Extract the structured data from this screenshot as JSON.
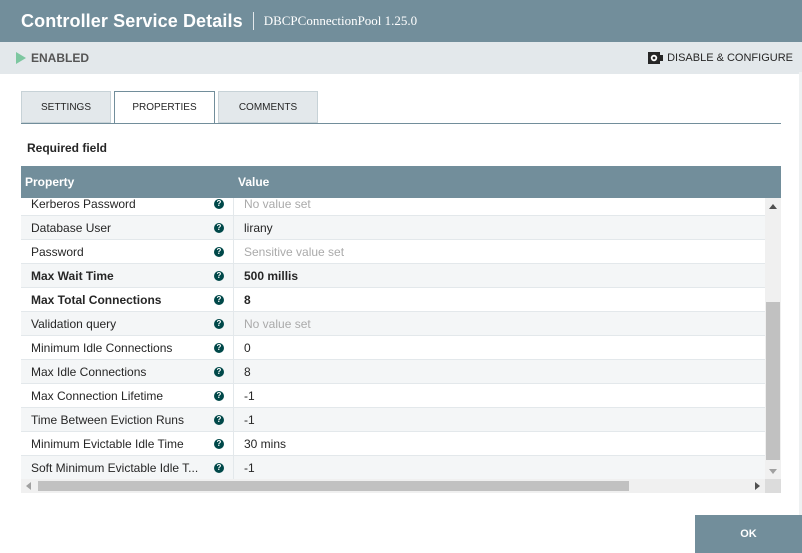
{
  "header": {
    "title": "Controller Service Details",
    "subtitle": "DBCPConnectionPool 1.25.0"
  },
  "status": {
    "state": "ENABLED",
    "state_color": "#7dc7a0",
    "action_label": "DISABLE & CONFIGURE",
    "action_icon": "gear-config-icon"
  },
  "tabs": [
    {
      "label": "SETTINGS",
      "active": false
    },
    {
      "label": "PROPERTIES",
      "active": true
    },
    {
      "label": "COMMENTS",
      "active": false
    }
  ],
  "required_label": "Required field",
  "grid": {
    "columns": [
      "Property",
      "Value"
    ],
    "rows": [
      {
        "property": "Kerberos Password",
        "value": "No value set",
        "required": false,
        "is_set": false
      },
      {
        "property": "Database User",
        "value": "lirany",
        "required": false,
        "is_set": true
      },
      {
        "property": "Password",
        "value": "Sensitive value set",
        "required": false,
        "is_set": false
      },
      {
        "property": "Max Wait Time",
        "value": "500 millis",
        "required": true,
        "is_set": true
      },
      {
        "property": "Max Total Connections",
        "value": "8",
        "required": true,
        "is_set": true
      },
      {
        "property": "Validation query",
        "value": "No value set",
        "required": false,
        "is_set": false
      },
      {
        "property": "Minimum Idle Connections",
        "value": "0",
        "required": false,
        "is_set": true
      },
      {
        "property": "Max Idle Connections",
        "value": "8",
        "required": false,
        "is_set": true
      },
      {
        "property": "Max Connection Lifetime",
        "value": "-1",
        "required": false,
        "is_set": true
      },
      {
        "property": "Time Between Eviction Runs",
        "value": "-1",
        "required": false,
        "is_set": true
      },
      {
        "property": "Minimum Evictable Idle Time",
        "value": "30 mins",
        "required": false,
        "is_set": true
      },
      {
        "property": "Soft Minimum Evictable Idle T...",
        "value": "-1",
        "required": false,
        "is_set": true
      }
    ]
  },
  "footer": {
    "ok_label": "OK"
  },
  "colors": {
    "header_bg": "#728e9b",
    "status_bg": "#e3e8eb",
    "help_icon": "#004849"
  }
}
